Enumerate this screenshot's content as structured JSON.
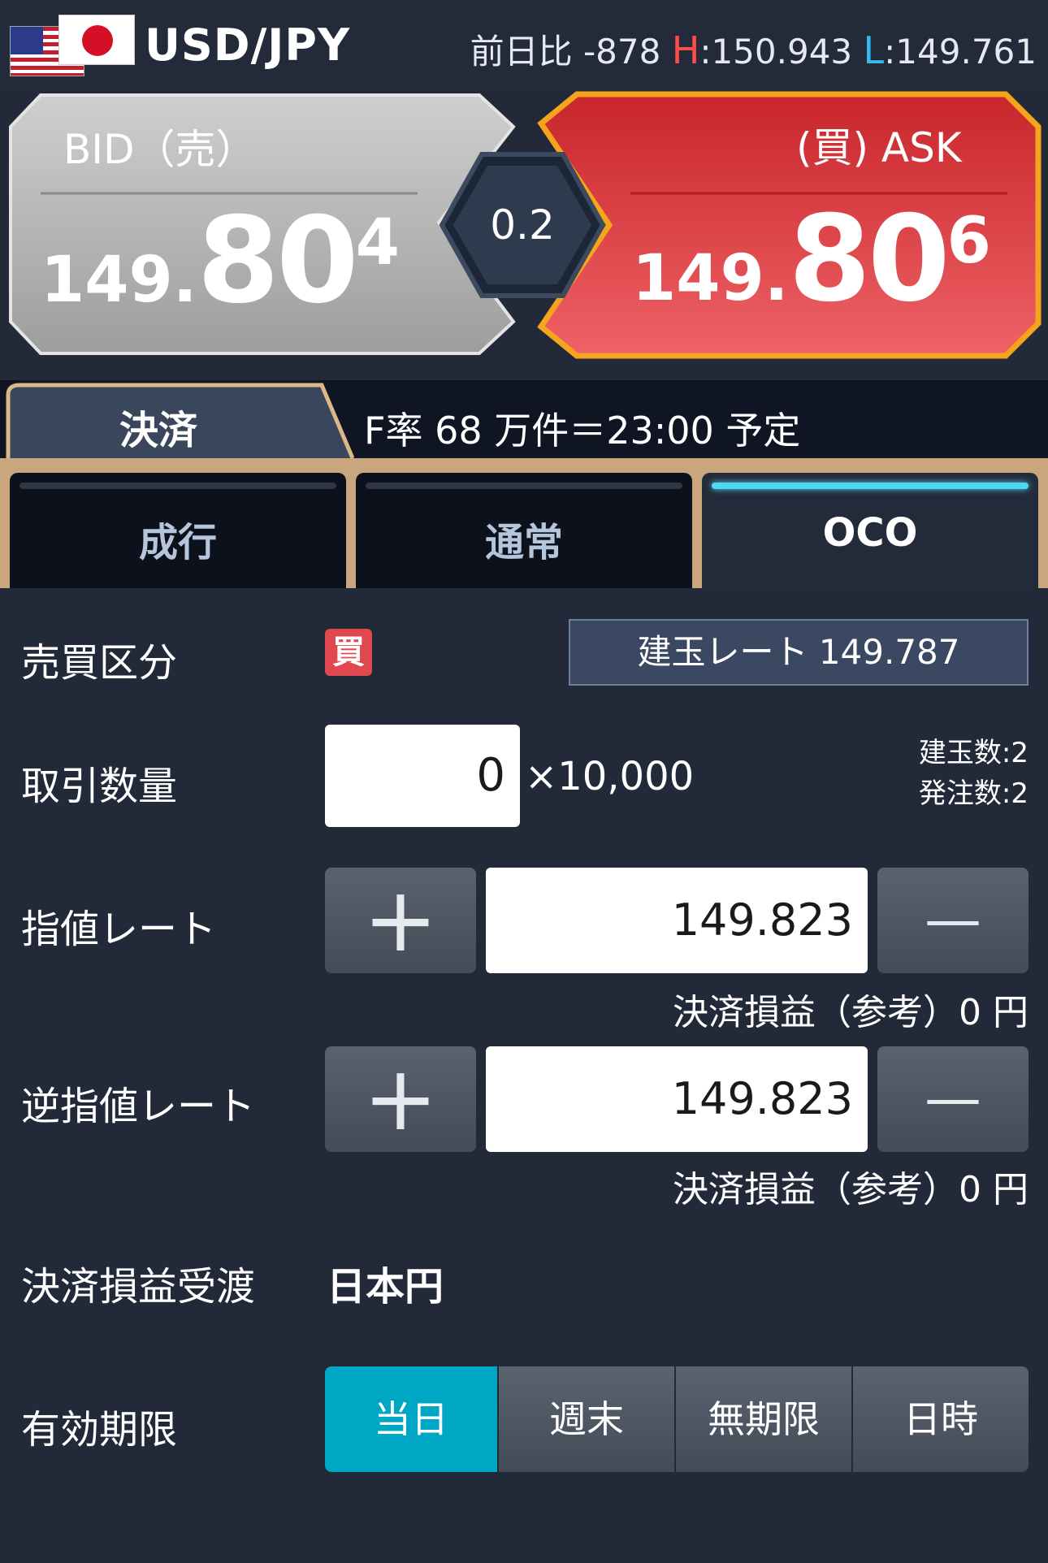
{
  "header": {
    "pair": "USD/JPY",
    "change_label": "前日比",
    "change_value": "-878",
    "high_letter": "H",
    "high_value": ":150.943",
    "low_letter": "L",
    "low_value": ":149.761"
  },
  "bid": {
    "label": "BID（売）",
    "price_lead": "149.",
    "price_big": "80",
    "price_last": "4"
  },
  "ask": {
    "label": "(買) ASK",
    "price_lead": "149.",
    "price_big": "80",
    "price_last": "6"
  },
  "spread": "0.2",
  "settle_tab": "決済",
  "ticker": "F率 68 万件＝23:00 予定",
  "order_tabs": [
    {
      "label": "成行",
      "active": false
    },
    {
      "label": "通常",
      "active": false
    },
    {
      "label": "OCO",
      "active": true
    }
  ],
  "form": {
    "side_label": "売買区分",
    "side_badge": "買",
    "position_rate": "建玉レート 149.787",
    "qty_label": "取引数量",
    "qty_value": "0",
    "qty_unit": "×10,000",
    "positions_count": "建玉数:2",
    "orders_count": "発注数:2",
    "limit_label": "指値レート",
    "limit_value": "149.823",
    "limit_pnl": "決済損益（参考）0 円",
    "stop_label": "逆指値レート",
    "stop_value": "149.823",
    "stop_pnl": "決済損益（参考）0 円",
    "plus_glyph": "+",
    "minus_glyph": "—",
    "currency_label": "決済損益受渡",
    "currency_value": "日本円",
    "expiry_label": "有効期限",
    "expiry_options": [
      "当日",
      "週末",
      "無期限",
      "日時"
    ],
    "expiry_selected": "当日"
  },
  "colors": {
    "background": "#222a3a",
    "bid_panel": "#a9a9a9",
    "ask_panel": "#de4a4c",
    "ask_border": "#f5a51d",
    "active_tab_bar": "#4fd8f0",
    "expiry_active": "#00a7c4",
    "band": "#c9a67d"
  }
}
